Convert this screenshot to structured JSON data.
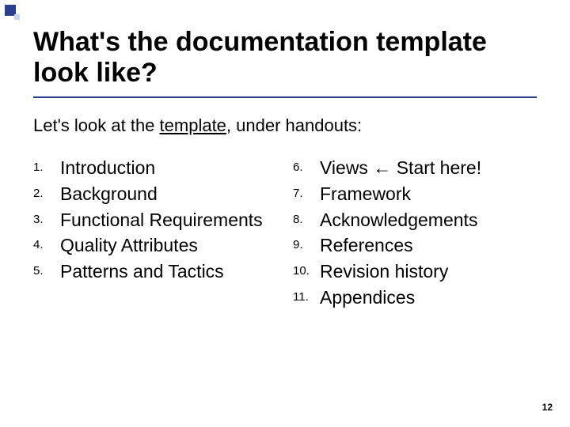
{
  "deco": {},
  "title": "What's the documentation template look like?",
  "subtitle_pre": "Let's look at the ",
  "subtitle_link": "template",
  "subtitle_post": ", under handouts:",
  "left": [
    {
      "n": "1.",
      "t": "Introduction"
    },
    {
      "n": "2.",
      "t": "Background"
    },
    {
      "n": "3.",
      "t": "Functional Requirements"
    },
    {
      "n": "4.",
      "t": "Quality Attributes"
    },
    {
      "n": "5.",
      "t": "Patterns and Tactics"
    }
  ],
  "right": [
    {
      "n": "6.",
      "t": "Views ← Start here!",
      "arrow": true
    },
    {
      "n": "7.",
      "t": "Framework"
    },
    {
      "n": "8.",
      "t": "Acknowledgements"
    },
    {
      "n": "9.",
      "t": "References"
    },
    {
      "n": "10.",
      "t": "Revision history"
    },
    {
      "n": "11.",
      "t": "Appendices"
    }
  ],
  "right_6_pre": "Views ",
  "right_6_arrow": "←",
  "right_6_post": " Start here!",
  "page_number": "12"
}
